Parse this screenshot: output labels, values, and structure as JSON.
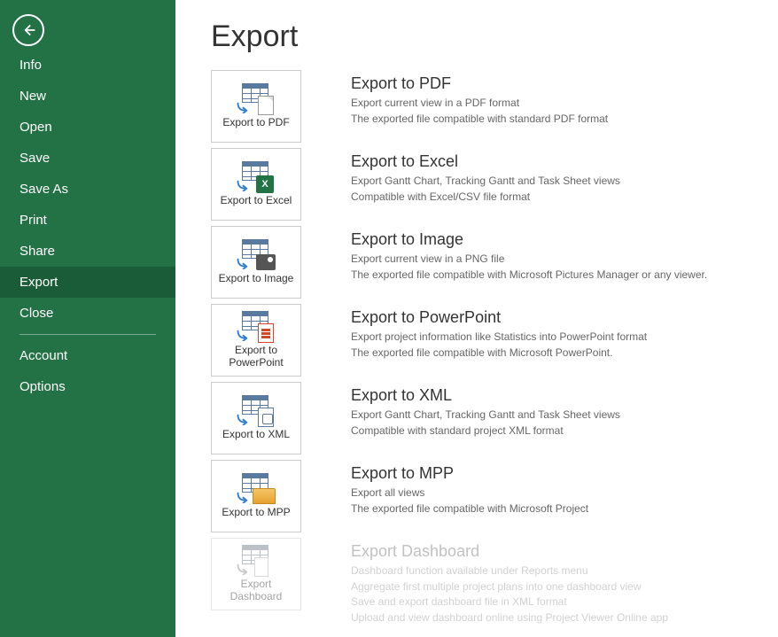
{
  "sidebar": {
    "items": [
      {
        "label": "Info"
      },
      {
        "label": "New"
      },
      {
        "label": "Open"
      },
      {
        "label": "Save"
      },
      {
        "label": "Save As"
      },
      {
        "label": "Print"
      },
      {
        "label": "Share"
      },
      {
        "label": "Export"
      },
      {
        "label": "Close"
      }
    ],
    "footer": [
      {
        "label": "Account"
      },
      {
        "label": "Options"
      }
    ]
  },
  "page": {
    "title": "Export"
  },
  "options": [
    {
      "tile": "Export to PDF",
      "title": "Export to PDF",
      "lines": [
        "Export current view in a PDF format",
        "The exported file compatible with standard PDF format"
      ]
    },
    {
      "tile": "Export to Excel",
      "title": "Export to Excel",
      "lines": [
        "Export Gantt Chart, Tracking Gantt and Task Sheet views",
        "Compatible with Excel/CSV file format"
      ]
    },
    {
      "tile": "Export to Image",
      "title": "Export to Image",
      "lines": [
        "Export current view in a PNG file",
        "The exported file compatible with Microsoft Pictures Manager or any viewer."
      ]
    },
    {
      "tile": "Export to PowerPoint",
      "title": "Export to PowerPoint",
      "lines": [
        "Export project information like Statistics into PowerPoint format",
        "The exported file compatible with Microsoft PowerPoint."
      ]
    },
    {
      "tile": "Export to XML",
      "title": "Export to XML",
      "lines": [
        "Export Gantt Chart, Tracking Gantt and Task Sheet views",
        "Compatible with standard project XML format"
      ]
    },
    {
      "tile": "Export to MPP",
      "title": "Export to MPP",
      "lines": [
        "Export all views",
        "The exported file compatible with Microsoft Project"
      ]
    },
    {
      "tile": "Export Dashboard",
      "title": "Export Dashboard",
      "lines": [
        "Dashboard function available under Reports menu",
        "Aggregate first multiple project plans into one dashboard view",
        "Save and export dashboard file in XML format",
        "Upload and view dashboard online using Project Viewer Online app"
      ]
    }
  ]
}
